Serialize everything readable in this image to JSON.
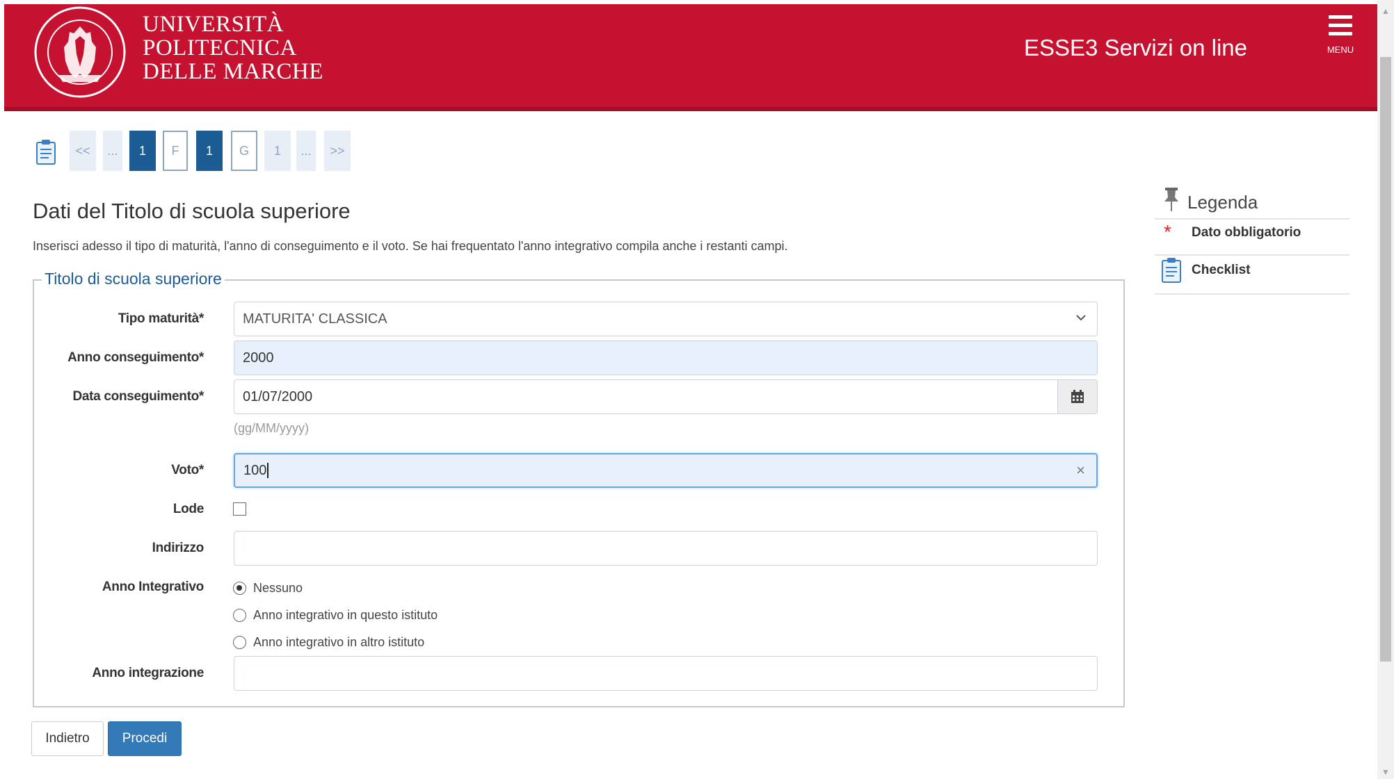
{
  "header": {
    "brand_line1": "UNIVERSITÀ",
    "brand_line2": "POLITECNICA",
    "brand_line3": "DELLE MARCHE",
    "app_title": "ESSE3 Servizi on line",
    "menu_label": "MENU",
    "seal_text": "UNIVERSITÀ POLITECNICA DELLE MARCHE",
    "brand_color": "#c41230"
  },
  "pager": {
    "icon": "checklist-icon",
    "items": [
      {
        "label": "<<",
        "style": "light"
      },
      {
        "label": "...",
        "style": "light"
      },
      {
        "label": "1",
        "style": "dark"
      },
      {
        "label": "F",
        "style": "outline"
      },
      {
        "label": "1",
        "style": "dark"
      },
      {
        "label": "G",
        "style": "outline"
      },
      {
        "label": "1",
        "style": "light"
      },
      {
        "label": "...",
        "style": "light"
      },
      {
        "label": ">>",
        "style": "light"
      }
    ]
  },
  "main": {
    "title": "Dati del Titolo di scuola superiore",
    "intro": "Inserisci adesso il tipo di maturità, l'anno di conseguimento e il voto. Se hai frequentato l'anno integrativo compila anche i restanti campi.",
    "fieldset_legend": "Titolo di scuola superiore"
  },
  "form": {
    "tipo_maturita": {
      "label": "Tipo maturità*",
      "value": "MATURITA' CLASSICA"
    },
    "anno_conseguimento": {
      "label": "Anno conseguimento*",
      "value": "2000"
    },
    "data_conseguimento": {
      "label": "Data conseguimento*",
      "value": "01/07/2000",
      "hint": "(gg/MM/yyyy)"
    },
    "voto": {
      "label": "Voto*",
      "value": "100",
      "clear": "×"
    },
    "lode": {
      "label": "Lode",
      "checked": false
    },
    "indirizzo": {
      "label": "Indirizzo",
      "value": ""
    },
    "anno_integrativo": {
      "label": "Anno Integrativo",
      "options": [
        {
          "label": "Nessuno",
          "checked": true
        },
        {
          "label": "Anno integrativo in questo istituto",
          "checked": false
        },
        {
          "label": "Anno integrativo in altro istituto",
          "checked": false
        }
      ]
    },
    "anno_integrazione": {
      "label": "Anno integrazione",
      "value": ""
    }
  },
  "buttons": {
    "back": "Indietro",
    "next": "Procedi",
    "primary_color": "#337ab7"
  },
  "legenda": {
    "title": "Legenda",
    "items": [
      {
        "icon": "required-star-icon",
        "label": "Dato obbligatorio"
      },
      {
        "icon": "checklist-icon",
        "label": "Checklist"
      }
    ]
  }
}
